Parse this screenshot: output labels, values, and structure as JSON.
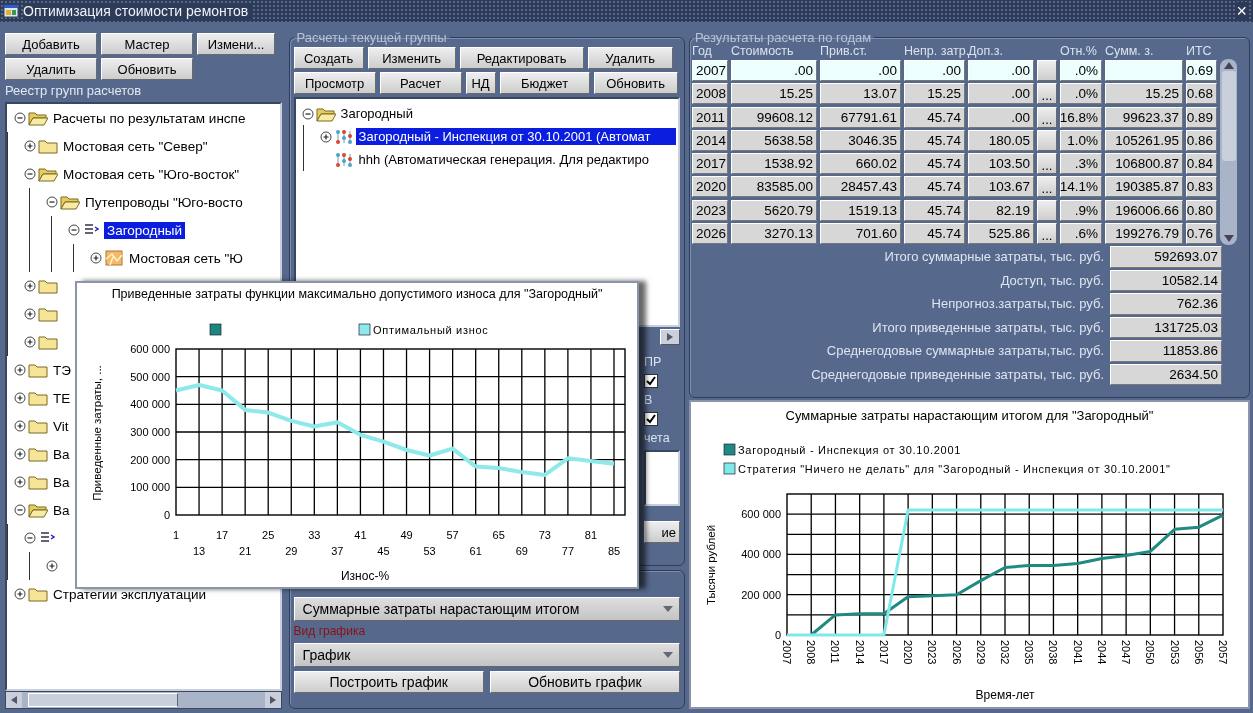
{
  "window": {
    "title": "Оптимизация стоимости ремонтов",
    "close": "×"
  },
  "registry": {
    "button_rows": [
      [
        "Добавить",
        "Мастер",
        "Измени..."
      ],
      [
        "Удалить",
        "Обновить"
      ]
    ],
    "title": "Реестр групп расчетов",
    "tree": [
      {
        "kind": "folder",
        "label": "Расчеты по результатам инспе",
        "expanded": true,
        "selected": false,
        "children": [
          {
            "kind": "folder",
            "label": "Мостовая сеть \"Север\"",
            "expanded": false,
            "selected": false
          },
          {
            "kind": "folder",
            "label": "Мостовая сеть \"Юго-восток\"",
            "expanded": true,
            "selected": false,
            "children": [
              {
                "kind": "folder",
                "label": "Путепроводы \"Юго-восто",
                "expanded": true,
                "selected": false,
                "children": [
                  {
                    "kind": "list",
                    "label": "Загородный",
                    "expanded": true,
                    "selected": true,
                    "children": [
                      {
                        "kind": "map",
                        "label": "Мостовая сеть \"Ю",
                        "expanded": false,
                        "selected": false
                      }
                    ]
                  }
                ]
              }
            ]
          },
          {
            "kind": "folder",
            "expanded": false,
            "selected": false
          },
          {
            "kind": "folder",
            "expanded": false,
            "selected": false
          },
          {
            "kind": "folder",
            "expanded": false,
            "selected": false
          }
        ]
      },
      {
        "kind": "folder",
        "label": "ТЭ",
        "expanded": false,
        "selected": false
      },
      {
        "kind": "folder",
        "label": "TE",
        "expanded": false,
        "selected": false
      },
      {
        "kind": "folder",
        "label": "Vit",
        "expanded": false,
        "selected": false
      },
      {
        "kind": "folder",
        "label": "Ba",
        "expanded": false,
        "selected": false
      },
      {
        "kind": "folder",
        "label": "Ba",
        "expanded": false,
        "selected": false
      },
      {
        "kind": "folder",
        "label": "Ba",
        "expanded": true,
        "selected": false,
        "children": [
          {
            "kind": "list",
            "expanded": true,
            "selected": false,
            "children": [
              {
                "expanded": false,
                "selected": false
              }
            ]
          }
        ]
      },
      {
        "kind": "folder",
        "label": "Стратегии эксплуатации",
        "expanded": false,
        "selected": false
      }
    ]
  },
  "current_group": {
    "title": "Расчеты текущей группы",
    "button_rows": [
      [
        "Создать",
        "Изменить",
        "Редактировать",
        "Удалить"
      ],
      [
        "Просмотр",
        "Расчет",
        "НД",
        "Бюджет",
        "Обновить"
      ]
    ],
    "tree": [
      {
        "kind": "folder",
        "label": "Загородный",
        "expanded": true,
        "selected": false,
        "children": [
          {
            "kind": "model",
            "label": "Загородный - Инспекция от 30.10.2001 (Автомат",
            "expanded": false,
            "selected": true
          },
          {
            "kind": "model",
            "label": "hhh (Автоматическая генерация. Для редактиро",
            "selected": false
          }
        ]
      }
    ],
    "partial_controls": [
      {
        "kind": "label",
        "text": "ПР"
      },
      {
        "kind": "checkbox",
        "checked": true
      },
      {
        "kind": "label",
        "text": "В"
      },
      {
        "kind": "checkbox",
        "checked": true
      },
      {
        "kind": "label",
        "text": "чета"
      },
      {
        "kind": "textarea"
      }
    ],
    "partial_button": "ие"
  },
  "chart_settings": {
    "chart_select": "Суммарные затраты нарастающим итогом",
    "type_label": "Вид графика",
    "type_select": "График",
    "buttons": [
      "Построить график",
      "Обновить график"
    ]
  },
  "results": {
    "title": "Результаты расчета по годам",
    "columns": [
      "Год",
      "Стоимость",
      "Прив.ст.",
      "Непр. затр.",
      "Доп.з.",
      "Отн.%",
      "Сумм. з.",
      "ИТС"
    ],
    "rows": [
      {
        "year": "2007",
        "cost": ".00",
        "discounted": ".00",
        "unforeseen": ".00",
        "extra": ".00",
        "rel": ".0%",
        "its": "0.69",
        "selected": true
      },
      {
        "year": "2008",
        "cost": "15.25",
        "discounted": "13.07",
        "unforeseen": "15.25",
        "extra": ".00",
        "detail": "...",
        "rel": ".0%",
        "sum": "15.25",
        "its": "0.68",
        "selected": false
      },
      {
        "year": "2011",
        "cost": "99608.12",
        "discounted": "67791.61",
        "unforeseen": "45.74",
        "extra": ".00",
        "detail": "...",
        "rel": "16.8%",
        "sum": "99623.37",
        "its": "0.89",
        "selected": false
      },
      {
        "year": "2014",
        "cost": "5638.58",
        "discounted": "3046.35",
        "unforeseen": "45.74",
        "extra": "180.05",
        "rel": "1.0%",
        "sum": "105261.95",
        "its": "0.86",
        "selected": false
      },
      {
        "year": "2017",
        "cost": "1538.92",
        "discounted": "660.02",
        "unforeseen": "45.74",
        "extra": "103.50",
        "detail": "...",
        "rel": ".3%",
        "sum": "106800.87",
        "its": "0.84",
        "selected": false
      },
      {
        "year": "2020",
        "cost": "83585.00",
        "discounted": "28457.43",
        "unforeseen": "45.74",
        "extra": "103.67",
        "detail": "...",
        "rel": "14.1%",
        "sum": "190385.87",
        "its": "0.83",
        "selected": false
      },
      {
        "year": "2023",
        "cost": "5620.79",
        "discounted": "1519.13",
        "unforeseen": "45.74",
        "extra": "82.19",
        "rel": ".9%",
        "sum": "196006.66",
        "its": "0.80",
        "selected": false
      },
      {
        "year": "2026",
        "cost": "3270.13",
        "discounted": "701.60",
        "unforeseen": "45.74",
        "extra": "525.86",
        "detail": "...",
        "rel": ".6%",
        "sum": "199276.79",
        "its": "0.76",
        "selected": false
      }
    ],
    "summary": [
      {
        "label": "Итого суммарные затраты, тыс. руб.",
        "value": "592693.07"
      },
      {
        "label": "Доступ, тыс. руб.",
        "value": "10582.14"
      },
      {
        "label": "Непрогноз.затраты,тыс. руб.",
        "value": "762.36"
      },
      {
        "label": "Итого приведенные затраты, тыс. руб.",
        "value": "131725.03"
      },
      {
        "label": "Среднегодовые суммарные затраты,тыс. руб.",
        "value": "11853.86"
      },
      {
        "label": "Среднегодовые приведенные затраты, тыс. руб.",
        "value": "2634.50"
      }
    ]
  },
  "results_chart": {
    "chart_data": {
      "type": "line",
      "title": "Суммарные затраты нарастающим итогом для \"Загородный\"",
      "xlabel": "Время-лет",
      "ylabel": "Тысячи рублей",
      "categories": [
        "2007",
        "2008",
        "2011",
        "2014",
        "2017",
        "2020",
        "2023",
        "2026",
        "2029",
        "2032",
        "2035",
        "2038",
        "2041",
        "2044",
        "2047",
        "2050",
        "2053",
        "2056",
        "2057"
      ],
      "series": [
        {
          "name": "Загородный - Инспекция от 30.10.2001",
          "color": "#1f8a82",
          "values": [
            null,
            0,
            100000,
            105000,
            105000,
            190000,
            195000,
            200000,
            270000,
            335000,
            345000,
            345000,
            355000,
            380000,
            395000,
            415000,
            525000,
            535000,
            595000
          ]
        },
        {
          "name": "Стратегия \"Ничего не делать\" для \"Загородный - Инспекция от 30.10.2001\"",
          "color": "#7fe9ea",
          "values": [
            0,
            0,
            0,
            0,
            0,
            620000,
            620000,
            620000,
            620000,
            620000,
            620000,
            620000,
            620000,
            620000,
            620000,
            620000,
            620000,
            620000,
            620000
          ]
        }
      ],
      "grid": true,
      "legend": true,
      "ylim": [
        0,
        700000
      ],
      "yticks": [
        {
          "value": 0,
          "label": "0"
        },
        {
          "value": 200000,
          "label": "200 000"
        },
        {
          "value": 400000,
          "label": "400 000"
        },
        {
          "value": 600000,
          "label": "600 000"
        }
      ]
    }
  },
  "popup_chart": {
    "chart_data": {
      "type": "line",
      "title": "Приведенные затраты функции максимально допустимого износа для \"Загородный\"",
      "xlabel": "Износ-%",
      "ylabel": "Приведенные затраты, ...",
      "categories": [
        "1",
        "13",
        "17",
        "21",
        "25",
        "29",
        "33",
        "37",
        "41",
        "45",
        "49",
        "53",
        "57",
        "61",
        "65",
        "69",
        "73",
        "77",
        "81",
        "85"
      ],
      "series": [
        {
          "color": "#17877f",
          "values": [
            null,
            null,
            null,
            null,
            null,
            null,
            null,
            null,
            null,
            null,
            null,
            null,
            null,
            null,
            null,
            null,
            null,
            null,
            null,
            null
          ]
        },
        {
          "name": "Оптимальный износ",
          "color": "#8de9ea",
          "values": [
            450000,
            470000,
            450000,
            380000,
            370000,
            340000,
            320000,
            335000,
            290000,
            265000,
            235000,
            215000,
            240000,
            175000,
            170000,
            155000,
            145000,
            205000,
            195000,
            185000
          ]
        }
      ],
      "grid": true,
      "legend": true,
      "ylim": [
        0,
        600000
      ],
      "yticks": [
        {
          "value": 0,
          "label": "0"
        },
        {
          "value": 100000,
          "label": "100 000"
        },
        {
          "value": 200000,
          "label": "200 000"
        },
        {
          "value": 300000,
          "label": "300 000"
        },
        {
          "value": 400000,
          "label": "400 000"
        },
        {
          "value": 500000,
          "label": "500 000"
        },
        {
          "value": 600000,
          "label": "600 000"
        }
      ]
    }
  }
}
